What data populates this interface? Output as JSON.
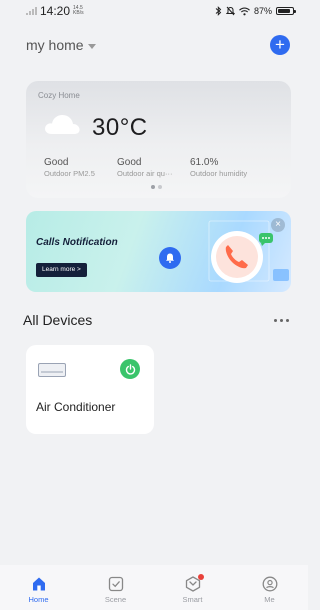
{
  "status_bar": {
    "time": "14:20",
    "net_speed_top": "14.5",
    "net_speed_bottom": "KB/s",
    "battery": "87%"
  },
  "header": {
    "home_name": "my home",
    "add_icon": "plus-icon"
  },
  "weather": {
    "home_label": "Cozy Home",
    "icon": "cloud-icon",
    "temperature": "30°C",
    "metrics": [
      {
        "value": "Good",
        "label": "Outdoor PM2.5"
      },
      {
        "value": "Good",
        "label": "Outdoor air qu···"
      },
      {
        "value": "61.0%",
        "label": "Outdoor humidity"
      }
    ],
    "pager_active": 0
  },
  "banner": {
    "title": "Calls Notification",
    "button_label": "Learn more >",
    "close_label": "×"
  },
  "devices": {
    "title": "All Devices",
    "items": [
      {
        "name": "Air Conditioner",
        "icon": "air-conditioner-icon",
        "power": "on"
      }
    ]
  },
  "tabs": [
    {
      "label": "Home",
      "icon": "home-icon",
      "active": true
    },
    {
      "label": "Scene",
      "icon": "scene-icon",
      "active": false
    },
    {
      "label": "Smart",
      "icon": "smart-icon",
      "active": false
    },
    {
      "label": "Me",
      "icon": "me-icon",
      "active": false
    }
  ],
  "colors": {
    "accent": "#2f6bf0",
    "power_on": "#3ac46b",
    "badge_red": "#e8413a"
  }
}
